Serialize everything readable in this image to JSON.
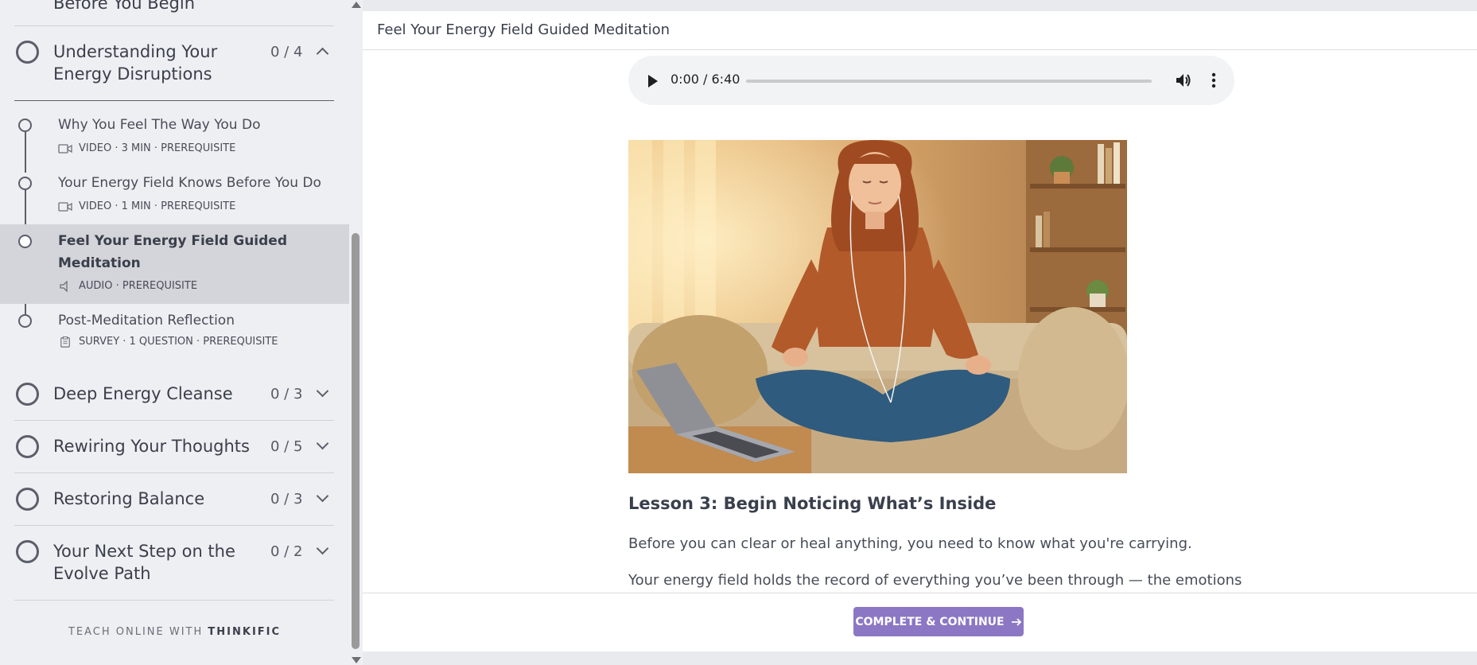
{
  "sidebar": {
    "prev_chapter_partial": "Before You Begin",
    "chapters": [
      {
        "title_line1": "Understanding Your",
        "title_line2": "Energy Disruptions",
        "count": "0 / 4",
        "expanded": true
      },
      {
        "title": "Deep Energy Cleanse",
        "count": "0 / 3"
      },
      {
        "title": "Rewiring Your Thoughts",
        "count": "0 / 5"
      },
      {
        "title": "Restoring Balance",
        "count": "0 / 3"
      },
      {
        "title_line1": "Your Next Step on the",
        "title_line2": "Evolve Path",
        "count": "0 / 2"
      }
    ],
    "lessons": [
      {
        "title": "Why You Feel The Way You Do",
        "meta": "VIDEO · 3 MIN · PREREQUISITE",
        "icon": "video-icon"
      },
      {
        "title": "Your Energy Field Knows Before You Do",
        "meta": "VIDEO · 1 MIN · PREREQUISITE",
        "icon": "video-icon"
      },
      {
        "title_line1": "Feel Your Energy Field Guided",
        "title_line2": "Meditation",
        "meta": "AUDIO · PREREQUISITE",
        "icon": "speaker-icon",
        "active": true
      },
      {
        "title": "Post-Meditation Reflection",
        "meta": "SURVEY · 1 QUESTION · PREREQUISITE",
        "icon": "clipboard-icon"
      }
    ],
    "footer_prefix": "TEACH ONLINE WITH",
    "footer_brand": "THINKIFIC"
  },
  "main": {
    "title": "Feel Your Energy Field Guided Meditation",
    "audio": {
      "time": "0:00 / 6:40"
    },
    "image_alt": "Woman meditating cross-legged on a sofa with earphones",
    "lesson_heading": "Lesson 3: Begin Noticing What’s Inside",
    "paragraph1": "Before you can clear or heal anything, you need to know what you're carrying.",
    "paragraph2": "Your energy field holds the record of everything you’ve been through — the emotions",
    "complete_button": "COMPLETE & CONTINUE"
  },
  "colors": {
    "accent": "#8b77c4",
    "sidebar_bg": "#eeeff2",
    "active_lesson_bg": "#d4d5da"
  }
}
